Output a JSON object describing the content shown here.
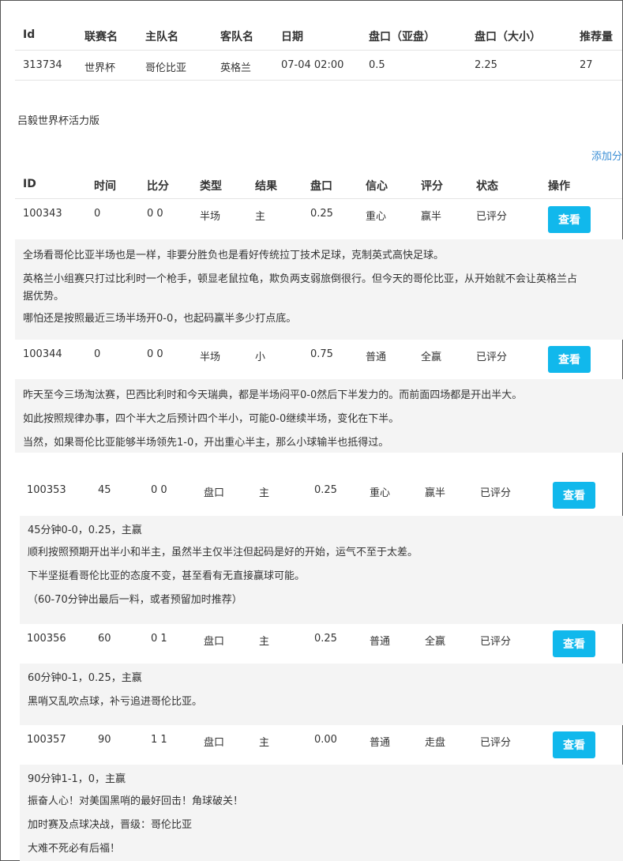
{
  "match": {
    "headers": [
      "Id",
      "联赛名",
      "主队名",
      "客队名",
      "日期",
      "盘口（亚盘）",
      "盘口（大小）",
      "推荐量"
    ],
    "row": [
      "313734",
      "世界杯",
      "哥伦比亚",
      "英格兰",
      "07-04 02:00",
      "0.5",
      "2.25",
      "27"
    ]
  },
  "expert": {
    "name": "吕毅世界杯活力版",
    "add_label": "添加分"
  },
  "tips_headers": [
    "ID",
    "时间",
    "比分",
    "类型",
    "结果",
    "盘口",
    "信心",
    "评分",
    "状态",
    "操作"
  ],
  "view_label": "查看",
  "tips": [
    {
      "cells": [
        "100343",
        "0",
        "0 0",
        "半场",
        "主",
        "0.25",
        "重心",
        "赢半",
        "已评分"
      ],
      "lines": [
        "全场看哥伦比亚半场也是一样，非要分胜负也是看好传统拉丁技术足球，克制英式高快足球。",
        "英格兰小组赛只打过比利时一个枪手，顿显老鼠拉龟，欺负两支弱旅倒很行。但今天的哥伦比亚，从开始就不会让英格兰占",
        "据优势。",
        "哪怕还是按照最近三场半场开0-0，也起码赢半多少打点底。"
      ]
    },
    {
      "cells": [
        "100344",
        "0",
        "0 0",
        "半场",
        "小",
        "0.75",
        "普通",
        "全赢",
        "已评分"
      ],
      "lines": [
        "昨天至今三场淘汰赛，巴西比利时和今天瑞典，都是半场闷平0-0然后下半发力的。而前面四场都是开出半大。",
        "如此按照规律办事，四个半大之后预计四个半小，可能0-0继续半场，变化在下半。",
        "当然，如果哥伦比亚能够半场领先1-0，开出重心半主，那么小球输半也抵得过。"
      ]
    },
    {
      "cells": [
        "100353",
        "45",
        "0 0",
        "盘口",
        "主",
        "0.25",
        "重心",
        "赢半",
        "已评分"
      ],
      "lines": [
        "45分钟0-0，0.25，主赢",
        "顺利按照预期开出半小和半主，虽然半主仅半注但起码是好的开始，运气不至于太差。",
        "下半坚挺看哥伦比亚的态度不变，甚至看有无直接赢球可能。",
        "（60-70分钟出最后一料，或者预留加时推荐）"
      ]
    },
    {
      "cells": [
        "100356",
        "60",
        "0 1",
        "盘口",
        "主",
        "0.25",
        "普通",
        "全赢",
        "已评分"
      ],
      "lines": [
        "60分钟0-1，0.25，主赢",
        "黑哨又乱吹点球，补亏追进哥伦比亚。"
      ]
    },
    {
      "cells": [
        "100357",
        "90",
        "1 1",
        "盘口",
        "主",
        "0.00",
        "普通",
        "走盘",
        "已评分"
      ],
      "lines": [
        "90分钟1-1，0，主赢",
        "振奋人心！对美国黑哨的最好回击！角球破关！",
        "加时赛及点球决战，晋级：哥伦比亚",
        "大难不死必有后福！"
      ]
    }
  ]
}
